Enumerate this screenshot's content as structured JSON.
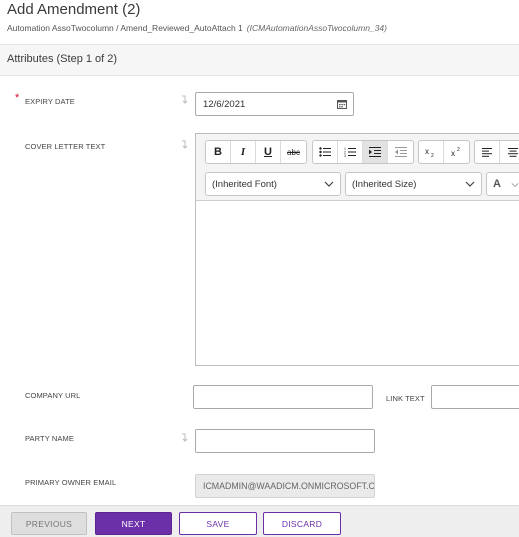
{
  "header": {
    "title": "Add Amendment (2)",
    "breadcrumb": "Automation AssoTwocolumn / Amend_Reviewed_AutoAttach 1",
    "breadcrumb_code": "(ICMAutomationAssoTwocolumn_34)"
  },
  "step": {
    "label": "Attributes (Step 1 of 2)"
  },
  "fields": {
    "expiry_date": {
      "label": "EXPIRY DATE",
      "required_mark": "*",
      "value": "12/6/2021"
    },
    "cover_letter": {
      "label": "COVER LETTER TEXT"
    },
    "company_url": {
      "label": "COMPANY URL",
      "value": ""
    },
    "link_text": {
      "label": "LINK TEXT",
      "value": ""
    },
    "party_name": {
      "label": "PARTY NAME",
      "value": ""
    },
    "primary_owner_email": {
      "label": "PRIMARY OWNER EMAIL",
      "value": "ICMADMIN@WAADICM.ONMICROSOFT.COM"
    }
  },
  "editor": {
    "bold": "B",
    "italic": "I",
    "underline": "U",
    "strike": "abc",
    "font_select": "(Inherited Font)",
    "size_select": "(Inherited Size)",
    "font_color": "A",
    "content": ""
  },
  "footer": {
    "previous": "PREVIOUS",
    "next": "NEXT",
    "save": "SAVE",
    "discard": "DISCARD"
  },
  "colors": {
    "accent": "#6b2fa8",
    "required": "#c8102e"
  }
}
